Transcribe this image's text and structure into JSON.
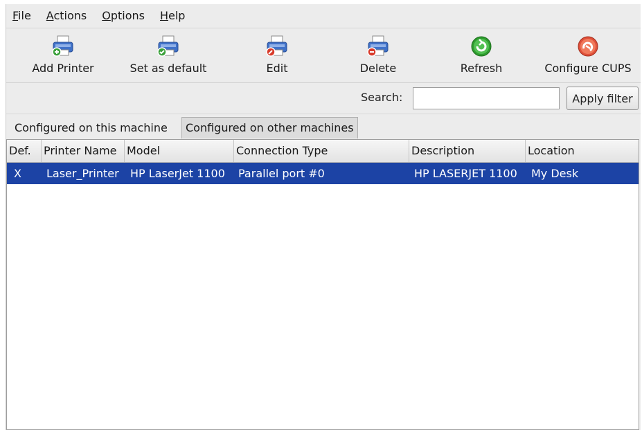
{
  "menu": {
    "items": [
      {
        "mnemonic": "F",
        "rest": "ile"
      },
      {
        "mnemonic": "A",
        "rest": "ctions"
      },
      {
        "mnemonic": "O",
        "rest": "ptions"
      },
      {
        "mnemonic": "H",
        "rest": "elp"
      }
    ]
  },
  "toolbar": {
    "buttons": [
      {
        "label": "Add Printer",
        "icon": "printer-add-icon"
      },
      {
        "label": "Set as default",
        "icon": "printer-default-icon"
      },
      {
        "label": "Edit",
        "icon": "printer-edit-icon"
      },
      {
        "label": "Delete",
        "icon": "printer-delete-icon"
      },
      {
        "label": "Refresh",
        "icon": "refresh-icon"
      },
      {
        "label": "Configure CUPS",
        "icon": "configure-cups-icon"
      }
    ]
  },
  "search": {
    "label": "Search:",
    "value": "",
    "apply_label": "Apply filter"
  },
  "tabs": [
    {
      "label": "Configured on this machine",
      "active": true
    },
    {
      "label": "Configured on other machines",
      "active": false
    }
  ],
  "table": {
    "columns": [
      "Def.",
      "Printer Name",
      "Model",
      "Connection Type",
      "Description",
      "Location"
    ],
    "rows": [
      {
        "default": "X",
        "name": "Laser_Printer",
        "model": "HP LaserJet 1100",
        "connection": "Parallel port #0",
        "description": "HP LASERJET 1100",
        "location": "My Desk",
        "selected": true
      }
    ]
  },
  "colors": {
    "selection": "#1c43a5",
    "add_badge": "#3aa03a",
    "delete_badge": "#d83a2a",
    "refresh": "#2e9c2e",
    "cups": "#e0503a"
  }
}
